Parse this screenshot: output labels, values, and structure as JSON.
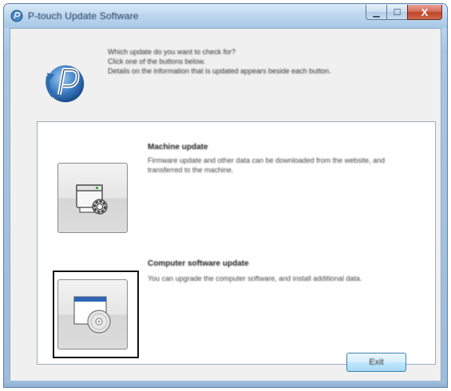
{
  "window": {
    "title": "P-touch Update Software",
    "controls": {
      "minimize": "▁",
      "maximize": "☐",
      "close": "X"
    }
  },
  "intro": {
    "line1": "Which update do you want to check for?",
    "line2": "Click one of the buttons below.",
    "line3": "Details on the information that is updated appears beside each button."
  },
  "options": [
    {
      "title": "Machine update",
      "description": "Firmware update and other data can be downloaded from the website, and transferred to the machine.",
      "icon": "printer-gear-icon"
    },
    {
      "title": "Computer software update",
      "description": "You can upgrade the computer software, and install additional data.",
      "icon": "window-cd-icon"
    }
  ],
  "footer": {
    "exit_label": "Exit"
  },
  "colors": {
    "title_bar": "#b9d3ec",
    "close_button": "#c0442a",
    "focus_frame": "#111111",
    "exit_border": "#3c7fb1"
  }
}
